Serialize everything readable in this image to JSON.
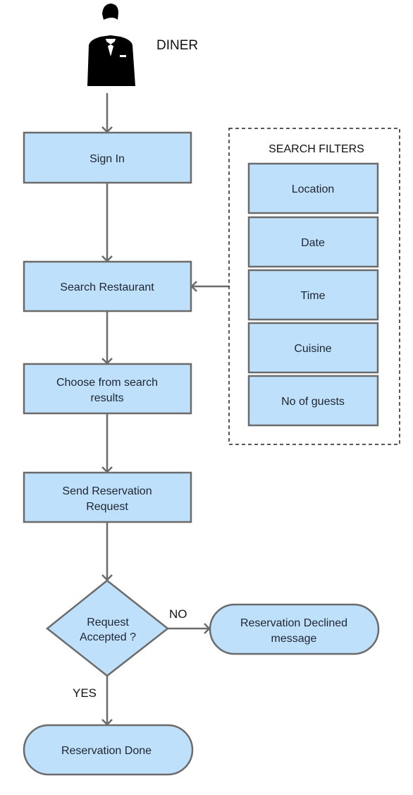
{
  "actor": {
    "label": "DINER",
    "icon": "person-in-tuxedo-icon"
  },
  "steps": {
    "sign_in": "Sign In",
    "search": "Search Restaurant",
    "choose": [
      "Choose from search",
      "results"
    ],
    "send": [
      "Send Reservation",
      "Request"
    ]
  },
  "decision": {
    "lines": [
      "Request",
      "Accepted ?"
    ],
    "yes": "YES",
    "no": "NO"
  },
  "outcomes": {
    "declined": [
      "Reservation Declined",
      "message"
    ],
    "done": "Reservation Done"
  },
  "filters": {
    "title": "SEARCH FILTERS",
    "items": [
      "Location",
      "Date",
      "Time",
      "Cuisine",
      "No of guests"
    ]
  },
  "colors": {
    "fill": "#bfe0fb",
    "stroke": "#6b6b6b"
  }
}
